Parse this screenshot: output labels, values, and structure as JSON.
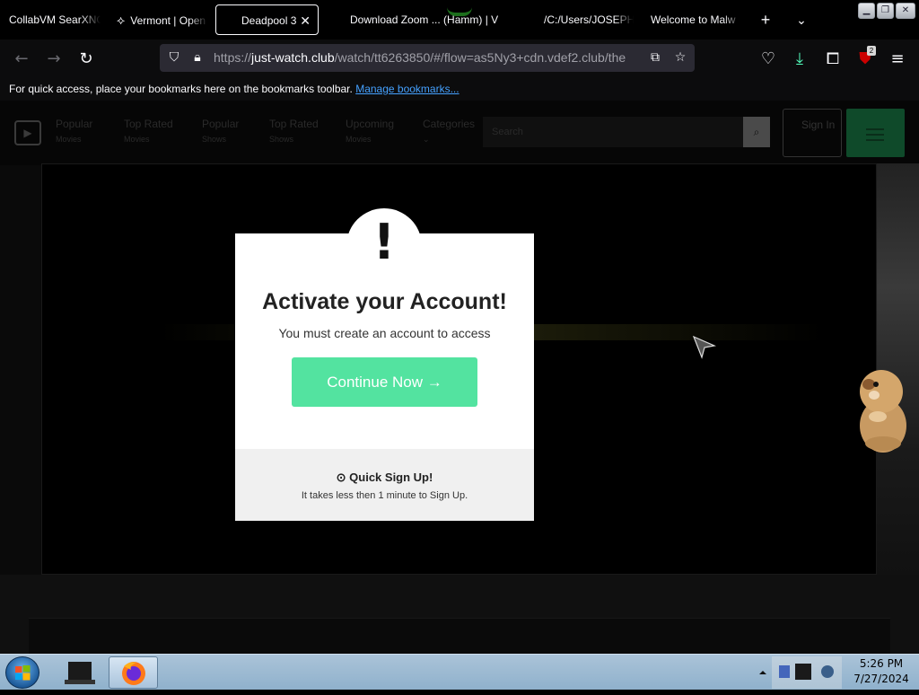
{
  "browser": {
    "tabs": [
      {
        "label": "CollabVM SearXNG",
        "icon": "searxng-icon"
      },
      {
        "label": "Vermont | Open",
        "icon": "openstreetmap-icon"
      },
      {
        "label": "Deadpool 3",
        "icon": "",
        "active": true
      },
      {
        "label": "Download Zoom ... (Hamm) | V",
        "icon": "download-icon"
      },
      {
        "label": "/C:/Users/JOSEPH",
        "icon": "file-icon"
      },
      {
        "label": "Welcome to Malw",
        "icon": "page-icon"
      }
    ],
    "url_prefix": "https://",
    "url_host": "just-watch.club",
    "url_rest": "/watch/tt6263850/#/flow=as5Ny3+cdn.vdef2.club/the",
    "extension_badge": "2",
    "bookmarks_text": "For quick access, place your bookmarks here on the bookmarks toolbar.",
    "bookmarks_link": "Manage bookmarks..."
  },
  "site": {
    "nav": [
      {
        "label": "Popular",
        "sub": "Movies"
      },
      {
        "label": "Top Rated",
        "sub": "Movies"
      },
      {
        "label": "Popular",
        "sub": "Shows"
      },
      {
        "label": "Top Rated",
        "sub": "Shows"
      },
      {
        "label": "Upcoming",
        "sub": "Movies"
      },
      {
        "label": "Categories",
        "sub": "⌄"
      }
    ],
    "search_placeholder": "Search",
    "signin_label": "Sign In"
  },
  "modal": {
    "icon": "!",
    "title": "Activate your Account!",
    "subtitle": "You must create an account to access",
    "button_label": "Continue Now →",
    "footer_title": "⊙ Quick Sign Up!",
    "footer_subtitle": "It takes less then 1 minute to Sign Up."
  },
  "taskbar": {
    "time": "5:26 PM",
    "date": "7/27/2024"
  },
  "colors": {
    "modal_button": "#53e3a0",
    "link": "#45a1ff",
    "taskbar": "#9fbcd3"
  }
}
